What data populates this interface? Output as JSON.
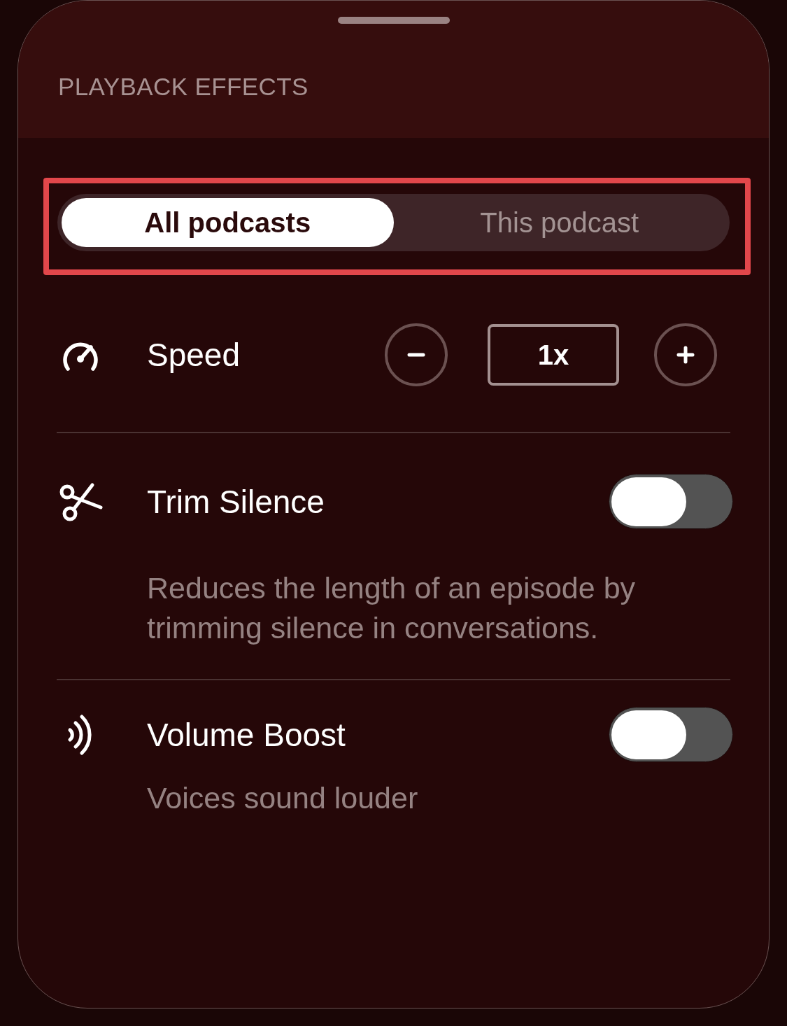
{
  "sheet": {
    "title": "PLAYBACK EFFECTS"
  },
  "scope_switch": {
    "highlighted": true,
    "tabs": [
      {
        "label": "All podcasts",
        "selected": true
      },
      {
        "label": "This podcast",
        "selected": false
      }
    ]
  },
  "settings": [
    {
      "kind": "stepper",
      "label": "Speed",
      "value": "1x"
    },
    {
      "kind": "toggle",
      "label": "Trim Silence",
      "on": false,
      "description": "Reduces the length of an episode by trimming silence in conversations."
    },
    {
      "kind": "toggle",
      "label": "Volume Boost",
      "on": false,
      "description": "Voices sound louder"
    }
  ]
}
